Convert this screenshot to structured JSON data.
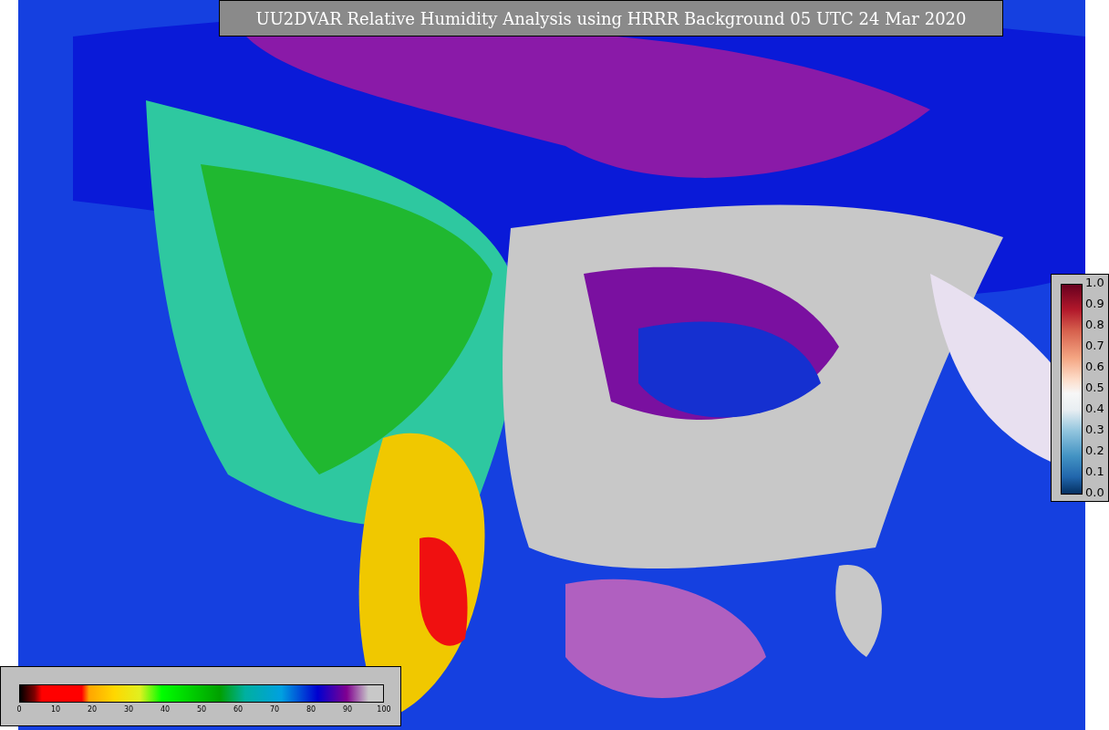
{
  "title": "UU2DVAR Relative Humidity Analysis using HRRR Background 05 UTC 24 Mar 2020",
  "humidity_colorbar": {
    "ticks": [
      "0",
      "10",
      "20",
      "30",
      "40",
      "50",
      "60",
      "70",
      "80",
      "90",
      "100"
    ]
  },
  "station_colorbar": {
    "ticks": [
      "1.0",
      "0.9",
      "0.8",
      "0.7",
      "0.6",
      "0.5",
      "0.4",
      "0.3",
      "0.2",
      "0.1",
      "0.0"
    ]
  }
}
